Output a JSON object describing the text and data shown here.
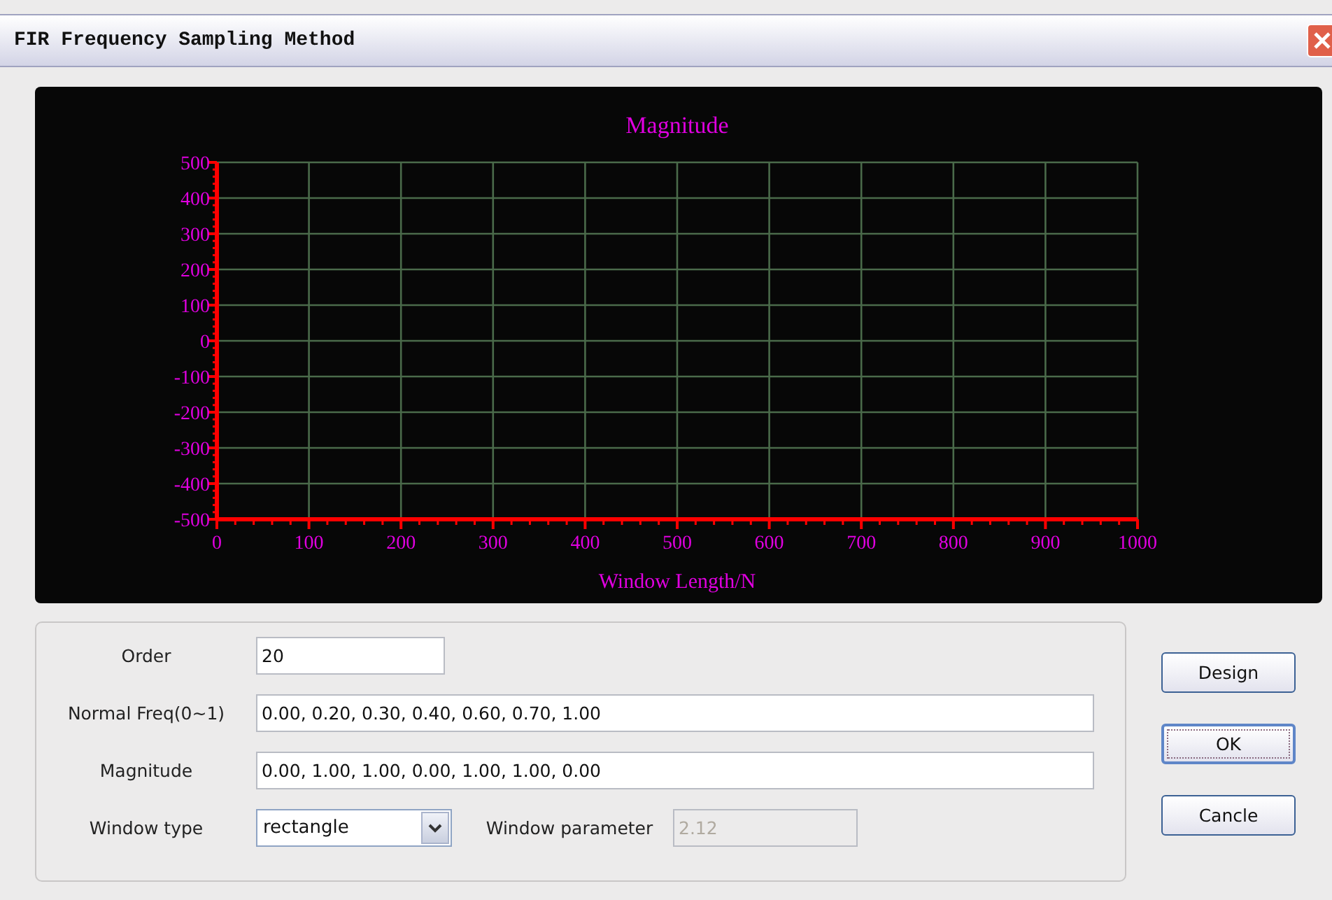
{
  "window": {
    "title": "FIR Frequency Sampling Method"
  },
  "chart": {
    "chart_data": {
      "type": "line",
      "title": "Magnitude",
      "xlabel": "Window Length/N",
      "xlim": [
        0,
        1000
      ],
      "ylim": [
        -500,
        500
      ],
      "xticks": [
        0,
        100,
        200,
        300,
        400,
        500,
        600,
        700,
        800,
        900,
        1000
      ],
      "yticks": [
        -500,
        -400,
        -300,
        -200,
        -100,
        0,
        100,
        200,
        300,
        400,
        500
      ],
      "grid": true
    }
  },
  "form": {
    "order": {
      "label": "Order",
      "value": "20"
    },
    "normal_freq": {
      "label": "Normal Freq(0~1)",
      "value": "0.00, 0.20, 0.30, 0.40, 0.60, 0.70, 1.00"
    },
    "magnitude": {
      "label": "Magnitude",
      "value": "0.00, 1.00, 1.00, 0.00, 1.00, 1.00, 0.00"
    },
    "window_type": {
      "label": "Window type",
      "value": "rectangle"
    },
    "window_parameter": {
      "label": "Window parameter",
      "value": "2.12",
      "disabled": true
    }
  },
  "buttons": [
    {
      "label": "Design",
      "focused": false
    },
    {
      "label": "OK",
      "focused": true
    },
    {
      "label": "Cancle",
      "focused": false
    }
  ]
}
